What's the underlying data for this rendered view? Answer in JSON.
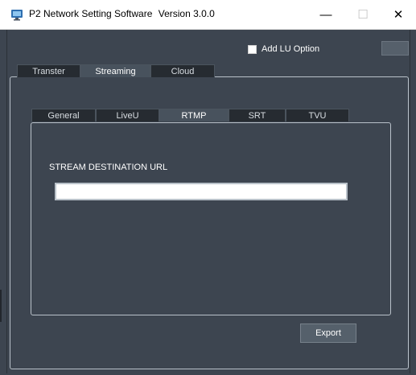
{
  "window": {
    "title_app": "P2 Network Setting Software",
    "title_version": "Version 3.0.0",
    "minimize_icon": "minimize-icon",
    "maximize_icon": "maximize-icon",
    "close_icon": "close-icon",
    "minimize_glyph": "—",
    "maximize_glyph": "☐",
    "close_glyph": "✕"
  },
  "options": {
    "add_lu_label": "Add LU Option",
    "add_lu_checked": false,
    "corner_button_label": "..."
  },
  "main_tabs": [
    {
      "label": "Transter",
      "active": false
    },
    {
      "label": "Streaming",
      "active": true
    },
    {
      "label": "Cloud",
      "active": false
    }
  ],
  "streaming_tabs": [
    {
      "label": "General",
      "active": false
    },
    {
      "label": "LiveU",
      "active": false
    },
    {
      "label": "RTMP",
      "active": true
    },
    {
      "label": "SRT",
      "active": false
    },
    {
      "label": "TVU",
      "active": false
    }
  ],
  "rtmp": {
    "url_label": "STREAM DESTINATION URL",
    "url_value": "",
    "url_placeholder": ""
  },
  "footer": {
    "export_label": "Export"
  },
  "colors": {
    "background": "#3d4550",
    "tab_inactive": "#262b31",
    "tab_active": "#48525d",
    "panel_border": "#b9c1c9"
  }
}
